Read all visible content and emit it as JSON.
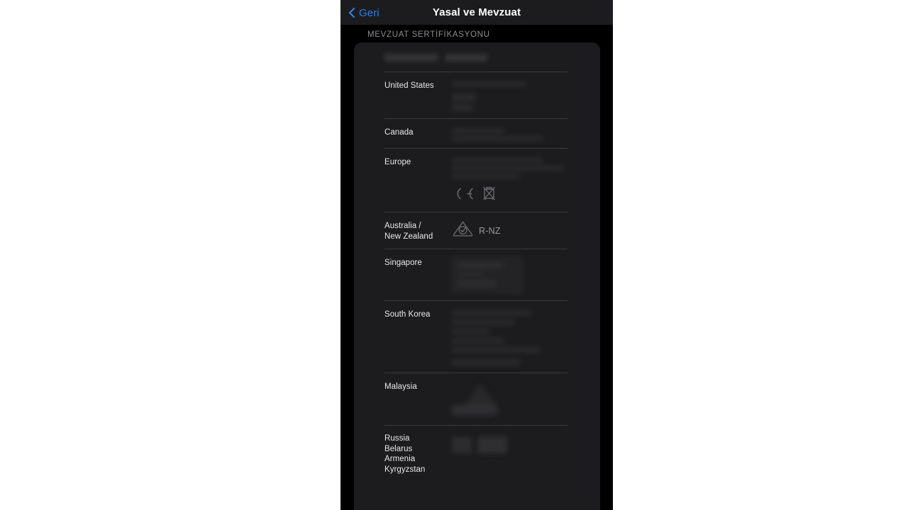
{
  "nav": {
    "back_label": "Geri",
    "back_icon": "chevron-left-icon",
    "title": "Yasal ve Mevzuat"
  },
  "section": {
    "header": "MEVZUAT SERTİFİKASYONU"
  },
  "colors": {
    "accent_blue": "#2f7fe8",
    "nav_background": "#1c1c1e",
    "card_background": "#1c1c1e",
    "screen_background": "#000000",
    "separator": "#3a3a3c",
    "label_text": "#e9e9ea",
    "secondary_text": "#8e8e93",
    "letterbox": "#ffffff"
  },
  "rows": [
    {
      "label": "",
      "content_kind": "redacted-model-line",
      "has_separator": false
    },
    {
      "label": "United States",
      "content_kind": "redacted-block",
      "has_separator": true
    },
    {
      "label": "Canada",
      "content_kind": "redacted-block",
      "has_separator": true
    },
    {
      "label": "Europe",
      "content_kind": "redacted-block-with-marks",
      "has_separator": true,
      "marks": [
        "ce-mark-icon",
        "weee-crossed-out-bin-icon"
      ]
    },
    {
      "label": "Australia /\nNew Zealand",
      "content_kind": "rcm-mark",
      "has_separator": true,
      "marks": [
        "rcm-triangle-icon"
      ],
      "mark_text": "R-NZ"
    },
    {
      "label": "Singapore",
      "content_kind": "redacted-panel",
      "has_separator": true
    },
    {
      "label": "South Korea",
      "content_kind": "redacted-block-large",
      "has_separator": true
    },
    {
      "label": "Malaysia",
      "content_kind": "redacted-logo",
      "has_separator": true
    },
    {
      "label": "Russia\nBelarus\nArmenia\nKyrgyzstan",
      "content_kind": "redacted-marks-pair",
      "has_separator": true
    }
  ]
}
